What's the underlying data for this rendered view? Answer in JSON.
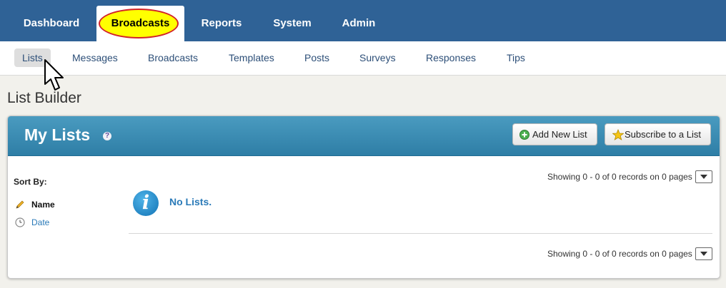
{
  "top_nav": {
    "tabs": [
      {
        "label": "Dashboard"
      },
      {
        "label": "Broadcasts",
        "active": true
      },
      {
        "label": "Reports"
      },
      {
        "label": "System"
      },
      {
        "label": "Admin"
      }
    ]
  },
  "sub_nav": {
    "items": [
      {
        "label": "Lists",
        "active": true
      },
      {
        "label": "Messages"
      },
      {
        "label": "Broadcasts"
      },
      {
        "label": "Templates"
      },
      {
        "label": "Posts"
      },
      {
        "label": "Surveys"
      },
      {
        "label": "Responses"
      },
      {
        "label": "Tips"
      }
    ]
  },
  "page": {
    "title": "List Builder"
  },
  "panel": {
    "title": "My Lists",
    "help_icon": "?",
    "buttons": {
      "add_new_list": "Add New List",
      "subscribe": "Subscribe to a List"
    },
    "sort": {
      "label": "Sort By:",
      "options": [
        {
          "label": "Name",
          "icon": "pencil-icon",
          "active": true
        },
        {
          "label": "Date",
          "icon": "clock-icon"
        }
      ]
    },
    "paging_top": "Showing 0 - 0 of 0 records on 0 pages",
    "paging_bottom": "Showing 0 - 0 of 0 records on 0 pages",
    "empty_message": "No Lists.",
    "info_icon": "i"
  },
  "colors": {
    "top_nav_bg": "#2f6296",
    "panel_header": "#3a8db5",
    "link": "#2a7ab8",
    "highlight_fill": "#ffff00",
    "highlight_stroke": "#d2232a"
  }
}
